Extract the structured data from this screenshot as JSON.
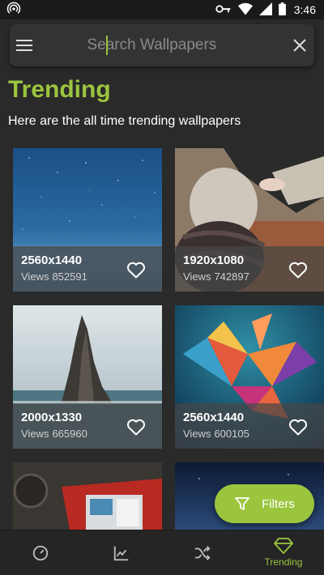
{
  "status_bar": {
    "time": "3:46",
    "icons": [
      "hotspot-icon",
      "vpn-key-icon",
      "wifi-icon",
      "signal-icon",
      "battery-icon"
    ]
  },
  "search": {
    "placeholder": "Search Wallpapers",
    "value": ""
  },
  "header": {
    "title": "Trending",
    "subtitle": "Here are the all time trending wallpapers"
  },
  "wallpapers": [
    {
      "resolution": "2560x1440",
      "views_label": "Views",
      "views": "852591"
    },
    {
      "resolution": "1920x1080",
      "views_label": "Views",
      "views": "742897"
    },
    {
      "resolution": "2000x1330",
      "views_label": "Views",
      "views": "665960"
    },
    {
      "resolution": "2560x1440",
      "views_label": "Views",
      "views": "600105"
    }
  ],
  "filters_button": {
    "label": "Filters"
  },
  "bottom_nav": {
    "items": [
      {
        "icon": "dashboard-icon",
        "label": ""
      },
      {
        "icon": "chart-icon",
        "label": ""
      },
      {
        "icon": "shuffle-icon",
        "label": ""
      },
      {
        "icon": "diamond-icon",
        "label": "Trending"
      }
    ]
  },
  "colors": {
    "accent": "#9bc53d",
    "background": "#2a2a2a",
    "search_bg": "#333333",
    "nav_bg": "#252525"
  }
}
